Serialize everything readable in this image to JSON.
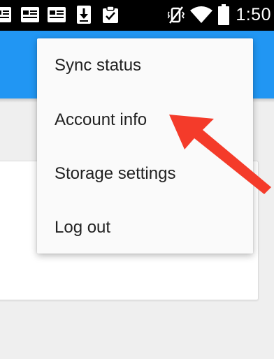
{
  "status_bar": {
    "time": "1:50",
    "notification_icons": [
      "news-icon",
      "news-icon",
      "news-icon",
      "download-icon",
      "clipboard-check-icon"
    ],
    "system_icons": [
      "vibrate-off-icon",
      "wifi-icon",
      "battery-icon"
    ]
  },
  "app_bar": {
    "color": "#2196f3"
  },
  "menu": {
    "items": [
      {
        "label": "Sync status"
      },
      {
        "label": "Account info"
      },
      {
        "label": "Storage settings"
      },
      {
        "label": "Log out"
      }
    ]
  },
  "annotation": {
    "icon": "arrow-icon",
    "color": "#f43b2a"
  }
}
